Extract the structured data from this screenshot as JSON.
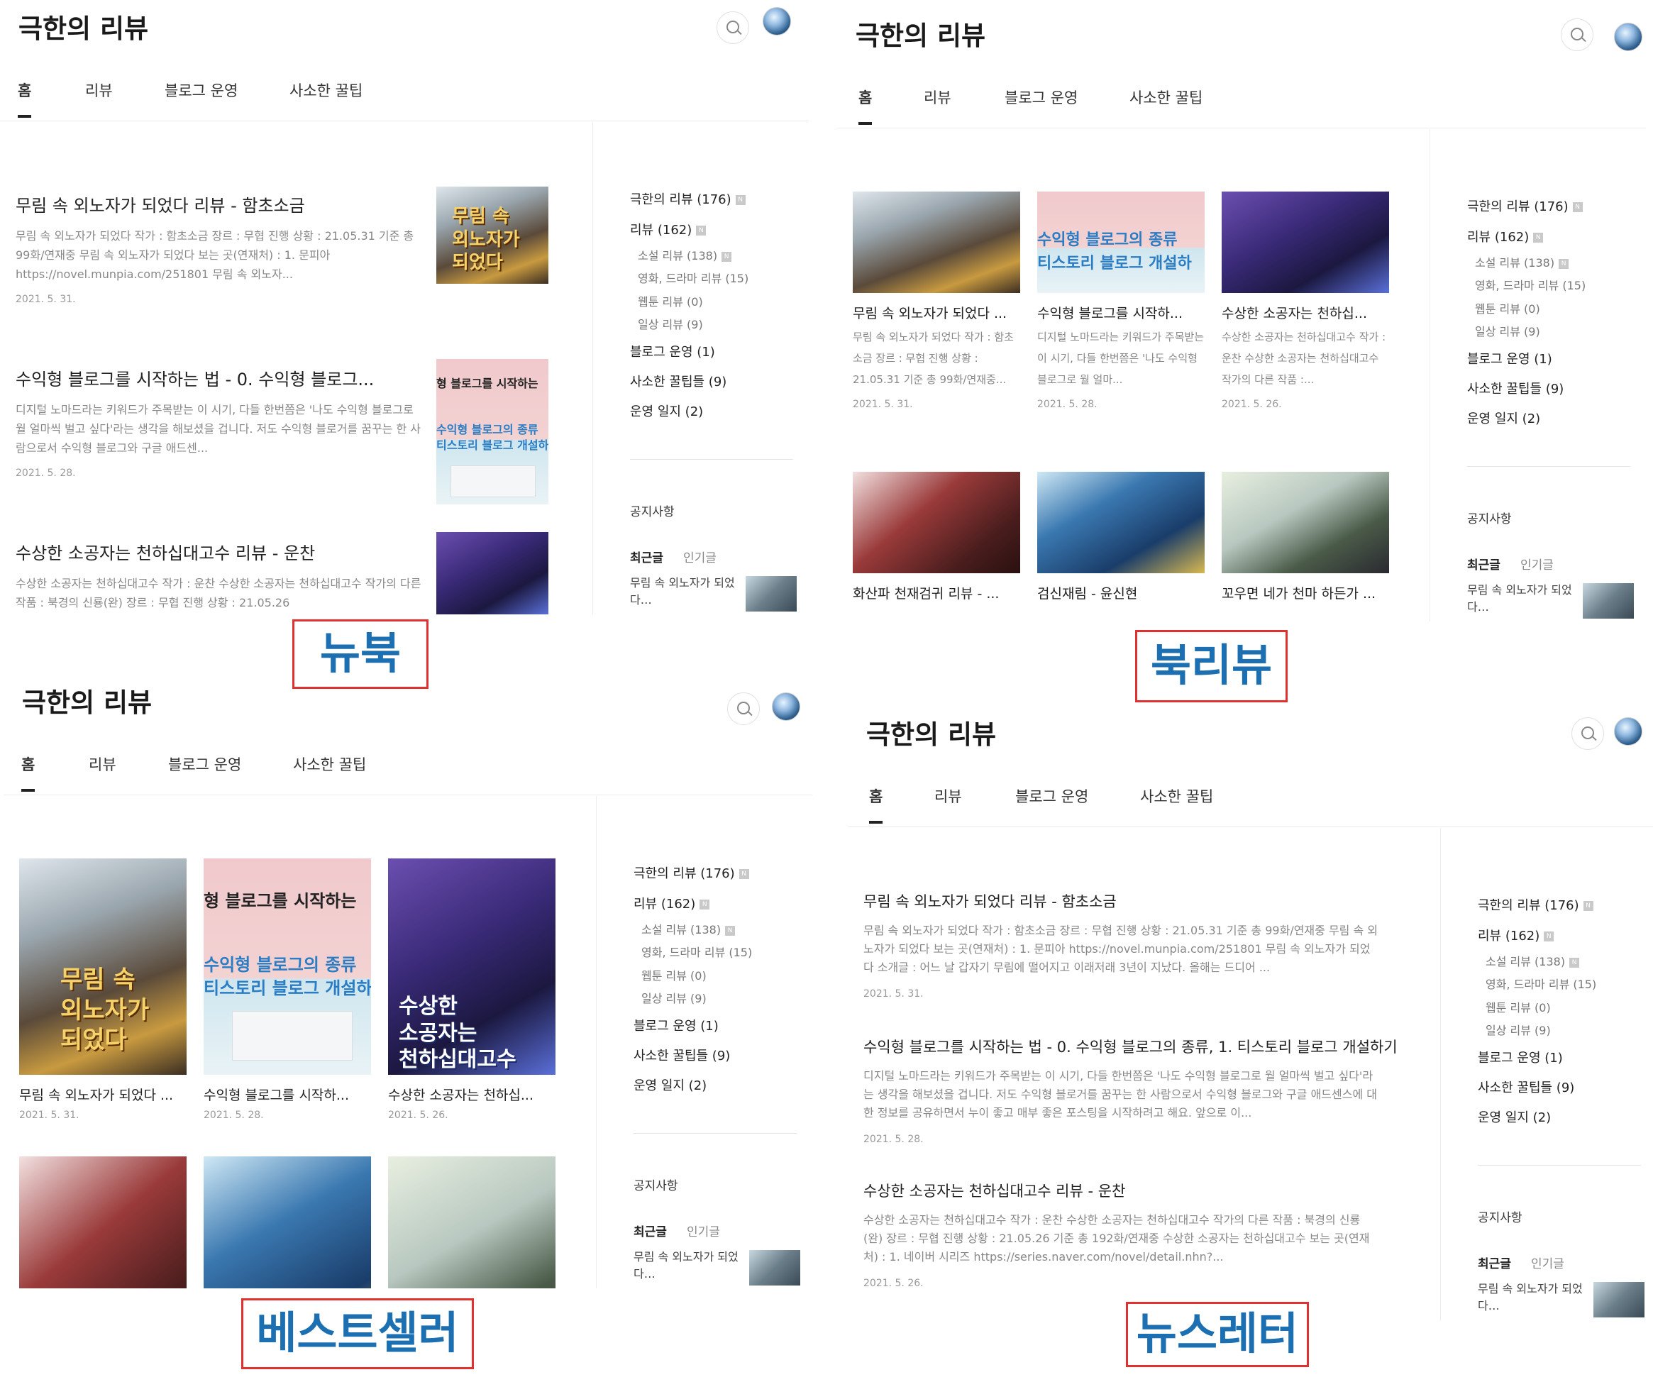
{
  "blog": {
    "title": "극한의 리뷰"
  },
  "icons": {
    "search": "search-icon",
    "avatar": "avatar-globe"
  },
  "nav": {
    "tabs": [
      "홈",
      "리뷰",
      "블로그 운영",
      "사소한 꿀팁"
    ]
  },
  "sidebar": {
    "categories": [
      {
        "label": "극한의 리뷰 (176)",
        "level": 0,
        "badge": true
      },
      {
        "label": "리뷰 (162)",
        "level": 0,
        "badge": true
      },
      {
        "label": "소설 리뷰 (138)",
        "level": 1,
        "badge": true
      },
      {
        "label": "영화, 드라마 리뷰 (15)",
        "level": 1,
        "badge": false
      },
      {
        "label": "웹툰 리뷰 (0)",
        "level": 1,
        "badge": false
      },
      {
        "label": "일상 리뷰 (9)",
        "level": 1,
        "badge": false
      },
      {
        "label": "블로그 운영 (1)",
        "level": 0,
        "badge": false
      },
      {
        "label": "사소한 꿀팁들 (9)",
        "level": 0,
        "badge": false
      },
      {
        "label": "운영 일지 (2)",
        "level": 0,
        "badge": false
      }
    ],
    "badge_letter": "N",
    "notice_title": "공지사항",
    "recent_tab": "최근글",
    "popular_tab": "인기글",
    "recent_post": "무림 속 외노자가 되었다…"
  },
  "posts": [
    {
      "title_full": "무림 속 외노자가 되었다 리뷰 - 함초소금",
      "title_trunc": "무림 속 외노자가 되었다 ...",
      "excerpt_wide": "무림 속 외노자가 되었다 작가 : 함초소금 장르 : 무협 진행 상황 : 21.05.31 기준 총 99화/연재중 무림 속 외노자가 되었다 보는 곳(연재처) : 1. 문피아 https://novel.munpia.com/251801 무림 속 외노자가 되었다 소개글 : 어느 날 갑자기 무림에 떨어지고 이래저래 3년이 지났다. 올해는 드디어 ...",
      "excerpt_list": "무림 속 외노자가 되었다 작가 : 함초소금 장르 : 무협 진행 상황 : 21.05.31 기준 총 99화/연재중 무림 속 외노자가 되었다 보는 곳(연재처) : 1. 문피아 https://novel.munpia.com/251801 무림 속 외노자...",
      "excerpt_card": "무림 속 외노자가 되었다 작가 : 함초소금 장르 : 무협 진행 상황 : 21.05.31 기준 총 99화/연재중...",
      "date": "2021. 5. 31.",
      "cover_text": "무림 속\n외노자가\n되었다"
    },
    {
      "title_full": "수익형 블로그를 시작하는 법 - 0. 수익형 블로그의 종류, 1. 티스토리 블로그 개설하기",
      "title_list": "수익형 블로그를 시작하는 법 - 0. 수익형 블로그...",
      "title_trunc": "수익형 블로그를 시작하...",
      "excerpt_wide": "디지털 노마드라는 키워드가 주목받는 이 시기, 다들 한번쯤은 '나도 수익형 블로그로 월 얼마씩 벌고 싶다'라는 생각을 해보셨을 겁니다. 저도 수익형 블로거를 꿈꾸는 한 사람으로서 수익형 블로그와 구글 애드센스에 대한 정보를 공유하면서 누이 좋고 매부 좋은 포스팅을 시작하려고 해요. 앞으로 이...",
      "excerpt_list": "디지털 노마드라는 키워드가 주목받는 이 시기, 다들 한번쯤은 '나도 수익형 블로그로 월 얼마씩 벌고 싶다'라는 생각을 해보셨을 겁니다. 저도 수익형 블로거를 꿈꾸는 한 사람으로서 수익형 블로그와 구글 애드센...",
      "excerpt_card": "디지털 노마드라는 키워드가 주목받는 이 시기, 다들 한번쯤은 '나도 수익형 블로그로 월 얼마...",
      "date": "2021. 5. 28.",
      "cover_line1": "형 블로그를 시작하는",
      "cover_line2": "수익형 블로그의 종류",
      "cover_line3": "티스토리 블로그 개설하"
    },
    {
      "title_full": "수상한 소공자는 천하십대고수 리뷰 - 운찬",
      "title_trunc": "수상한 소공자는 천하십...",
      "excerpt_wide": "수상한 소공자는 천하십대고수 작가 : 운찬 수상한 소공자는 천하십대고수 작가의 다른 작품 : 북경의 신룡(완) 장르 : 무협 진행 상황 : 21.05.26 기준 총 192화/연재중 수상한 소공자는 천하십대고수 보는 곳(연재처) : 1. 네이버 시리즈 https://series.naver.com/novel/detail.nhn?...",
      "excerpt_list": "수상한 소공자는 천하십대고수 작가 : 운찬 수상한 소공자는 천하십대고수 작가의 다른 작품 : 북경의 신룡(완) 장르 : 무협 진행 상황 : 21.05.26",
      "excerpt_card": "수상한 소공자는 천하십대고수 작가 : 운찬 수상한 소공자는 천하십대고수 작가의 다른 작품 :...",
      "date": "2021. 5. 26.",
      "cover_text": "수상한\n소공자는\n천하십대고수"
    },
    {
      "title_trunc": "화산파 천재검귀 리뷰 - ..."
    },
    {
      "title_trunc": "검신재림 - 윤신현"
    },
    {
      "title_trunc": "꼬우면 네가 천마 하든가 ..."
    }
  ],
  "layout_labels": {
    "newbook": "뉴북",
    "bookreview": "북리뷰",
    "bestseller": "베스트셀러",
    "newsletter": "뉴스레터"
  }
}
